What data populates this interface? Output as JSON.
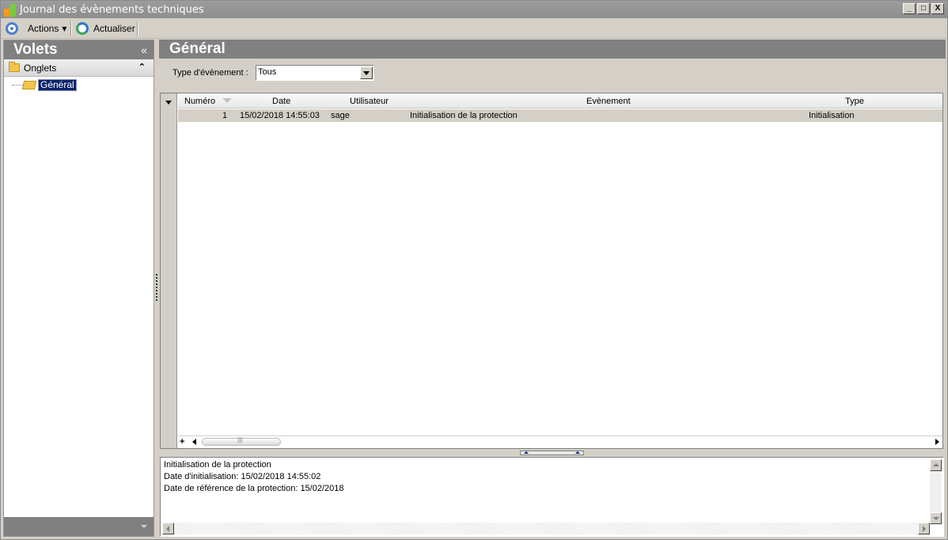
{
  "window": {
    "title": "Journal des évènements techniques",
    "minimize_label": "_",
    "maximize_label": "□",
    "close_label": "X"
  },
  "toolbar": {
    "actions_label": "Actions",
    "actions_arrow": "▾",
    "refresh_label": "Actualiser"
  },
  "left_panel": {
    "title": "Volets",
    "collapse_glyph": "«",
    "section_label": "Onglets",
    "section_toggle_glyph": "⌃",
    "tree_items": [
      {
        "label": "Général",
        "selected": true
      }
    ]
  },
  "right_panel": {
    "title": "Général",
    "filter": {
      "label": "Type d'évènement :",
      "value": "Tous"
    },
    "grid": {
      "columns": [
        "Numéro",
        "Date",
        "Utilisateur",
        "Evènement",
        "Type"
      ],
      "rows": [
        {
          "numero": "1",
          "date": "15/02/2018 14:55:03",
          "utilisateur": "sage",
          "evenement": "Initialisation de la protection",
          "type": "Initialisation"
        }
      ],
      "add_glyph": "+"
    },
    "detail": {
      "lines": [
        "Initialisation de la protection",
        "Date d'initialisation: 15/02/2018 14:55:02",
        "Date de référence de la protection: 15/02/2018"
      ]
    }
  },
  "colors": {
    "header_gray": "#808080",
    "selection_blue": "#0a246a",
    "window_bg": "#d4d0c8"
  }
}
